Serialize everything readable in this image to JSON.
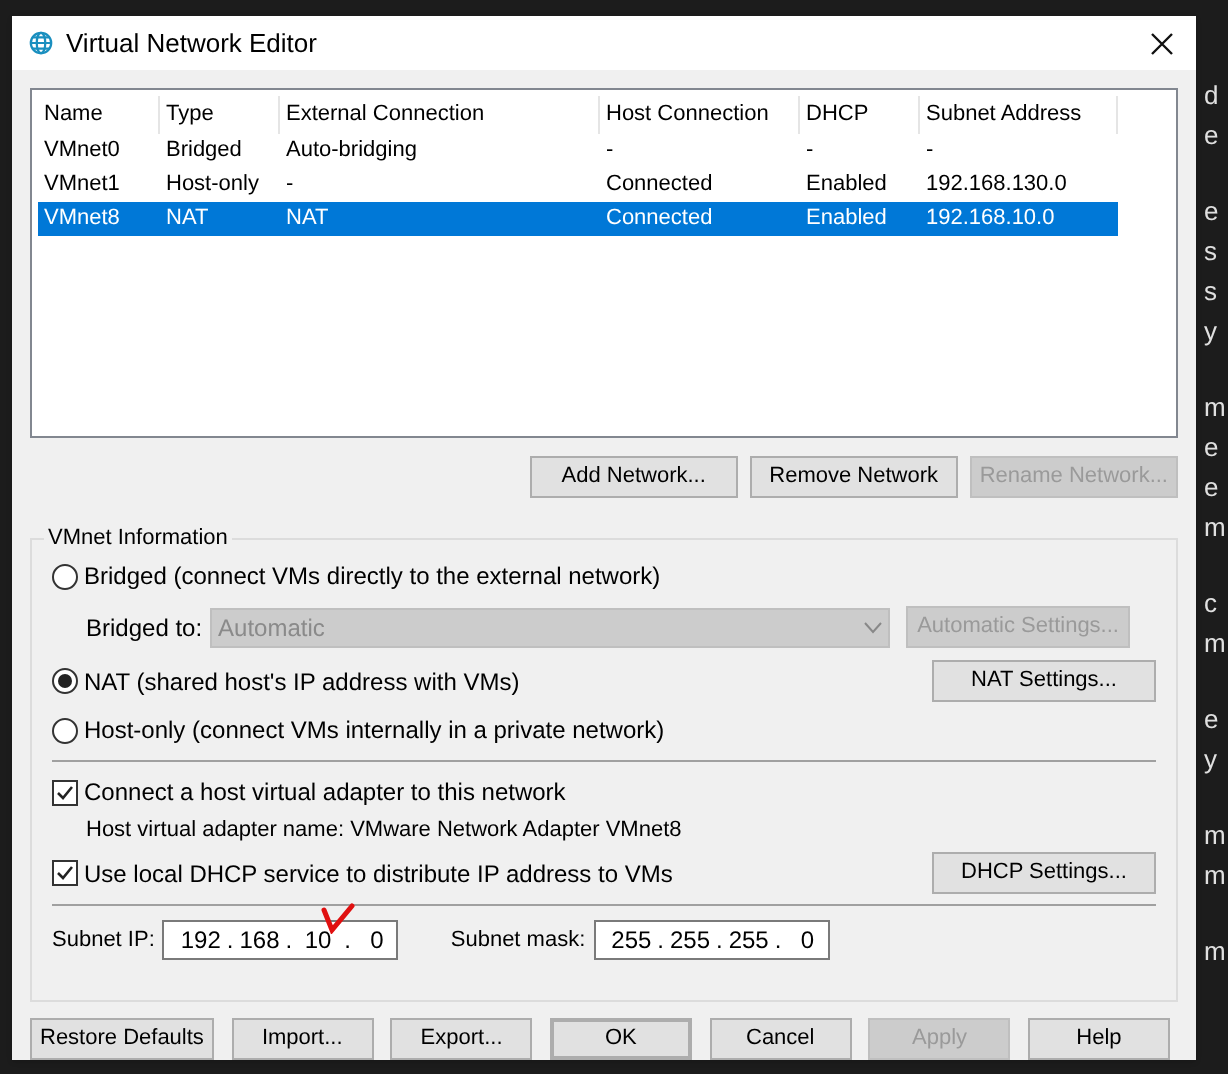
{
  "window": {
    "title": "Virtual Network Editor"
  },
  "table": {
    "columns": [
      "Name",
      "Type",
      "External Connection",
      "Host Connection",
      "DHCP",
      "Subnet Address"
    ],
    "rows": [
      {
        "cells": [
          "VMnet0",
          "Bridged",
          "Auto-bridging",
          "-",
          "-",
          "-"
        ],
        "selected": false
      },
      {
        "cells": [
          "VMnet1",
          "Host-only",
          "-",
          "Connected",
          "Enabled",
          "192.168.130.0"
        ],
        "selected": false
      },
      {
        "cells": [
          "VMnet8",
          "NAT",
          "NAT",
          "Connected",
          "Enabled",
          "192.168.10.0"
        ],
        "selected": true
      }
    ]
  },
  "network_buttons": [
    {
      "label": "Add Network...",
      "disabled": false
    },
    {
      "label": "Remove Network",
      "disabled": false
    },
    {
      "label": "Rename Network...",
      "disabled": true
    }
  ],
  "vmnet_info": {
    "title": "VMnet Information",
    "modes": [
      {
        "label": "Bridged (connect VMs directly to the external network)",
        "selected": false
      },
      {
        "label": "NAT (shared host's IP address with VMs)",
        "selected": true
      },
      {
        "label": "Host-only (connect VMs internally in a private network)",
        "selected": false
      }
    ],
    "bridged_to": {
      "label": "Bridged to:",
      "value": "Automatic",
      "disabled": true,
      "button": {
        "label": "Automatic Settings...",
        "disabled": true
      }
    },
    "nat_settings": {
      "label": "NAT Settings...",
      "disabled": false
    },
    "host_adapter": {
      "label": "Connect a host virtual adapter to this network",
      "checked": true,
      "name_text": "Host virtual adapter name: VMware Network Adapter VMnet8"
    },
    "dhcp": {
      "label": "Use local DHCP service to distribute IP address to VMs",
      "checked": true,
      "button": {
        "label": "DHCP Settings...",
        "disabled": false
      }
    },
    "subnet_ip": {
      "label": "Subnet IP:",
      "separator": ".",
      "octets": [
        "192",
        "168",
        "10",
        "0"
      ]
    },
    "subnet_mask": {
      "label": "Subnet mask:",
      "separator": ".",
      "octets": [
        "255",
        "255",
        "255",
        "0"
      ]
    }
  },
  "footer_buttons": [
    {
      "label": "Restore Defaults",
      "disabled": false,
      "default": false
    },
    {
      "label": "Import...",
      "disabled": false,
      "default": false
    },
    {
      "label": "Export...",
      "disabled": false,
      "default": false
    },
    {
      "label": "OK",
      "disabled": false,
      "default": true
    },
    {
      "label": "Cancel",
      "disabled": false,
      "default": false
    },
    {
      "label": "Apply",
      "disabled": true,
      "default": false
    },
    {
      "label": "Help",
      "disabled": false,
      "default": false
    }
  ],
  "background_text": [
    [
      "d",
      "e"
    ],
    [
      "e",
      "s",
      "s",
      "y"
    ],
    [
      "m",
      "e",
      "e",
      "m"
    ],
    [
      "c",
      "m"
    ],
    [
      "e",
      "y"
    ],
    [
      "m",
      "m"
    ],
    [
      "m"
    ]
  ]
}
